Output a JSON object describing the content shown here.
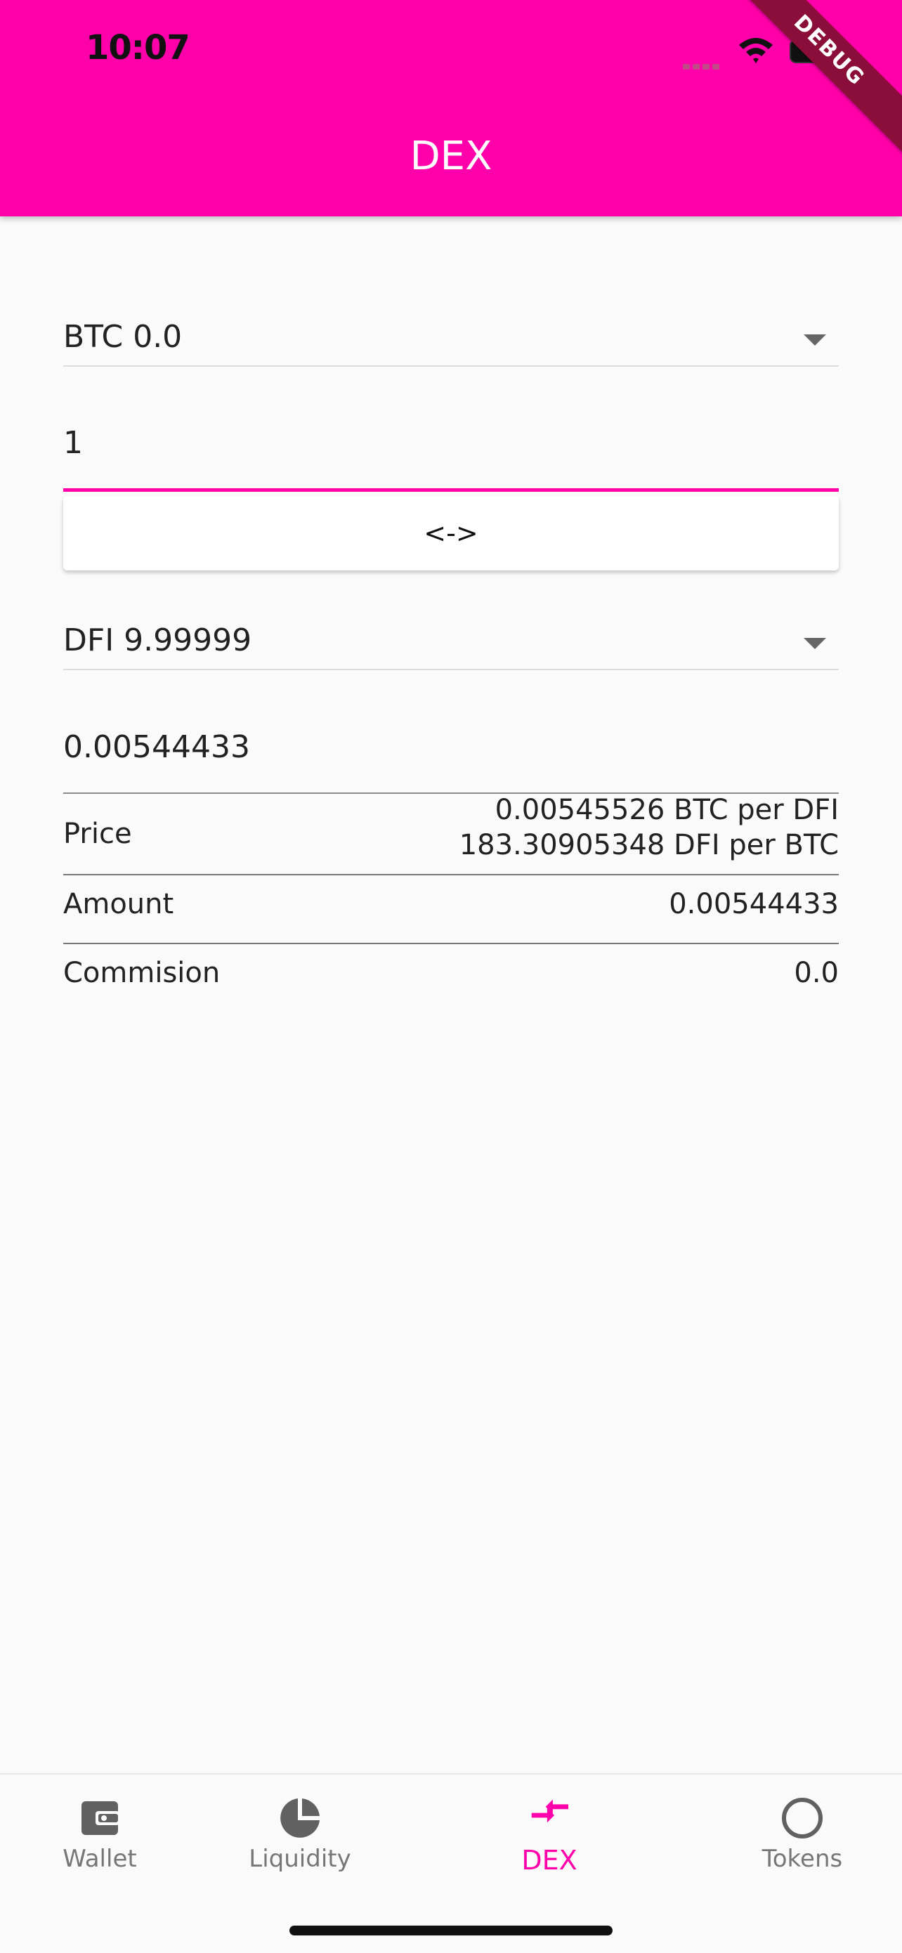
{
  "status_bar": {
    "time": "10:07"
  },
  "appbar": {
    "title": "DEX",
    "debug_label": "DEBUG"
  },
  "from": {
    "token": "BTC 0.0",
    "amount": "1"
  },
  "swap_button_label": "<->",
  "to": {
    "token": "DFI 9.99999",
    "amount": "0.00544433"
  },
  "details": {
    "price_label": "Price",
    "price_line1": "0.00545526 BTC per DFI",
    "price_line2": "183.30905348 DFI per BTC",
    "amount_label": "Amount",
    "amount_value": "0.00544433",
    "commission_label": "Commision",
    "commission_value": "0.0"
  },
  "bottom_nav": {
    "items": [
      {
        "label": "Wallet",
        "icon": "wallet-icon",
        "active": false
      },
      {
        "label": "Liquidity",
        "icon": "pie-chart-icon",
        "active": false
      },
      {
        "label": "DEX",
        "icon": "swap-arrows-icon",
        "active": true
      },
      {
        "label": "Tokens",
        "icon": "circle-icon",
        "active": false
      }
    ]
  },
  "colors": {
    "primary": "#ff00aa",
    "background": "#fafafa",
    "inactive_icon": "#616161"
  }
}
